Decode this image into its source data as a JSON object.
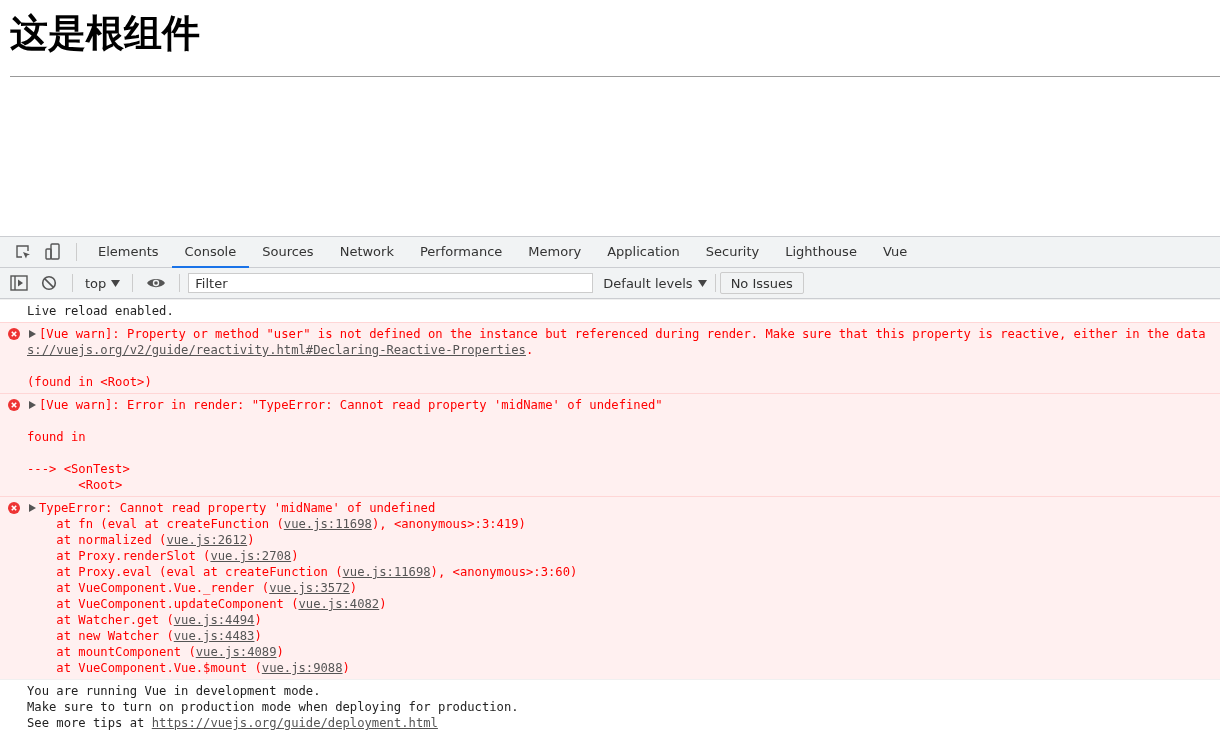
{
  "page": {
    "heading": "这是根组件"
  },
  "devtools": {
    "tabs": [
      {
        "label": "Elements",
        "selected": false
      },
      {
        "label": "Console",
        "selected": true
      },
      {
        "label": "Sources",
        "selected": false
      },
      {
        "label": "Network",
        "selected": false
      },
      {
        "label": "Performance",
        "selected": false
      },
      {
        "label": "Memory",
        "selected": false
      },
      {
        "label": "Application",
        "selected": false
      },
      {
        "label": "Security",
        "selected": false
      },
      {
        "label": "Lighthouse",
        "selected": false
      },
      {
        "label": "Vue",
        "selected": false
      }
    ],
    "toolbar": {
      "context": "top",
      "filter": {
        "placeholder": "Filter"
      },
      "levels": "Default levels",
      "issues": "No Issues"
    },
    "messages": [
      {
        "kind": "info",
        "expandable": false,
        "paragraphs": [
          [
            {
              "parts": [
                {
                  "text": "Live reload enabled."
                }
              ]
            }
          ]
        ]
      },
      {
        "kind": "error",
        "expandable": true,
        "paragraphs": [
          [
            {
              "parts": [
                {
                  "text": "[Vue warn]: Property or method \"user\" is not defined on the instance but referenced during render. Make sure that this property is reactive, either in the data"
                }
              ]
            },
            {
              "parts": [
                {
                  "text": "s://vuejs.org/v2/guide/reactivity.html#Declaring-Reactive-Properties",
                  "link": true
                },
                {
                  "text": "."
                }
              ]
            }
          ],
          [
            {
              "parts": [
                {
                  "text": "(found in <Root>)"
                }
              ]
            }
          ]
        ]
      },
      {
        "kind": "error",
        "expandable": true,
        "paragraphs": [
          [
            {
              "parts": [
                {
                  "text": "[Vue warn]: Error in render: \"TypeError: Cannot read property 'midName' of undefined\""
                }
              ]
            }
          ],
          [
            {
              "parts": [
                {
                  "text": "found in"
                }
              ]
            }
          ],
          [
            {
              "parts": [
                {
                  "text": "---> <SonTest>"
                }
              ]
            },
            {
              "parts": [
                {
                  "text": "       <Root>"
                }
              ]
            }
          ]
        ]
      },
      {
        "kind": "error",
        "expandable": true,
        "paragraphs": [
          [
            {
              "parts": [
                {
                  "text": "TypeError: Cannot read property 'midName' of undefined"
                }
              ]
            },
            {
              "parts": [
                {
                  "text": "    at fn (eval at createFunction ("
                },
                {
                  "text": "vue.js:11698",
                  "link": true
                },
                {
                  "text": "), <anonymous>:3:419)"
                }
              ]
            },
            {
              "parts": [
                {
                  "text": "    at normalized ("
                },
                {
                  "text": "vue.js:2612",
                  "link": true
                },
                {
                  "text": ")"
                }
              ]
            },
            {
              "parts": [
                {
                  "text": "    at Proxy.renderSlot ("
                },
                {
                  "text": "vue.js:2708",
                  "link": true
                },
                {
                  "text": ")"
                }
              ]
            },
            {
              "parts": [
                {
                  "text": "    at Proxy.eval (eval at createFunction ("
                },
                {
                  "text": "vue.js:11698",
                  "link": true
                },
                {
                  "text": "), <anonymous>:3:60)"
                }
              ]
            },
            {
              "parts": [
                {
                  "text": "    at VueComponent.Vue._render ("
                },
                {
                  "text": "vue.js:3572",
                  "link": true
                },
                {
                  "text": ")"
                }
              ]
            },
            {
              "parts": [
                {
                  "text": "    at VueComponent.updateComponent ("
                },
                {
                  "text": "vue.js:4082",
                  "link": true
                },
                {
                  "text": ")"
                }
              ]
            },
            {
              "parts": [
                {
                  "text": "    at Watcher.get ("
                },
                {
                  "text": "vue.js:4494",
                  "link": true
                },
                {
                  "text": ")"
                }
              ]
            },
            {
              "parts": [
                {
                  "text": "    at new Watcher ("
                },
                {
                  "text": "vue.js:4483",
                  "link": true
                },
                {
                  "text": ")"
                }
              ]
            },
            {
              "parts": [
                {
                  "text": "    at mountComponent ("
                },
                {
                  "text": "vue.js:4089",
                  "link": true
                },
                {
                  "text": ")"
                }
              ]
            },
            {
              "parts": [
                {
                  "text": "    at VueComponent.Vue.$mount ("
                },
                {
                  "text": "vue.js:9088",
                  "link": true
                },
                {
                  "text": ")"
                }
              ]
            }
          ]
        ]
      },
      {
        "kind": "info",
        "expandable": false,
        "paragraphs": [
          [
            {
              "parts": [
                {
                  "text": "You are running Vue in development mode."
                }
              ]
            },
            {
              "parts": [
                {
                  "text": "Make sure to turn on production mode when deploying for production."
                }
              ]
            },
            {
              "parts": [
                {
                  "text": "See more tips at "
                },
                {
                  "text": "https://vuejs.org/guide/deployment.html",
                  "link": true
                }
              ]
            }
          ]
        ]
      }
    ]
  }
}
